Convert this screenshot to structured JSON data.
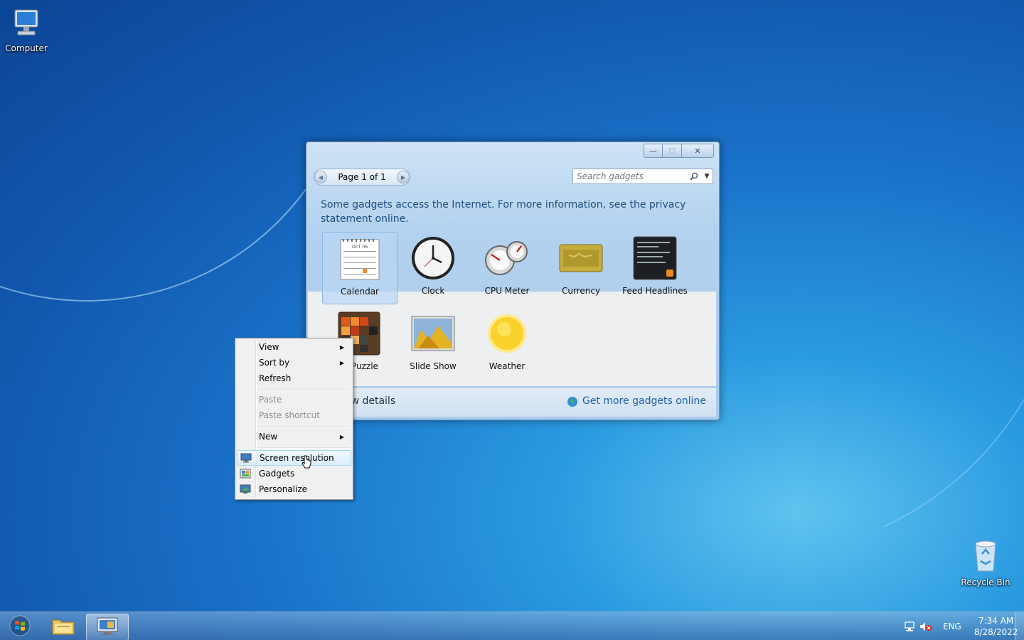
{
  "desktop": {
    "icons": [
      {
        "label": "Computer"
      },
      {
        "label": "Recycle Bin"
      }
    ]
  },
  "gadgets_window": {
    "controls": {
      "minimize": "—",
      "maximize": "☐",
      "close": "✕"
    },
    "page_nav": {
      "label": "Page 1 of 1"
    },
    "search": {
      "placeholder": "Search gadgets"
    },
    "info_text": "Some gadgets access the Internet.  For more information, see the privacy statement online.",
    "gadgets": [
      {
        "label": "Calendar",
        "selected": true
      },
      {
        "label": "Clock"
      },
      {
        "label": "CPU Meter"
      },
      {
        "label": "Currency"
      },
      {
        "label": "Feed Headlines"
      },
      {
        "label": "re Puzzle"
      },
      {
        "label": "Slide Show"
      },
      {
        "label": "Weather"
      }
    ],
    "calendar_month": "OCT 06",
    "footer": {
      "details_label": "ow details",
      "online_link": "Get more gadgets online"
    }
  },
  "context_menu": {
    "items": [
      {
        "label": "View",
        "submenu": true
      },
      {
        "label": "Sort by",
        "submenu": true
      },
      {
        "label": "Refresh"
      },
      {
        "label": "Paste",
        "disabled": true
      },
      {
        "label": "Paste shortcut",
        "disabled": true
      },
      {
        "label": "New",
        "submenu": true
      },
      {
        "label": "Screen resolution",
        "hovered": true
      },
      {
        "label": "Gadgets"
      },
      {
        "label": "Personalize"
      }
    ]
  },
  "taskbar": {
    "tray": {
      "language": "ENG",
      "time": "7:34 AM",
      "date": "8/28/2022"
    }
  },
  "colors": {
    "accent": "#1a72c9",
    "link": "#1f5fa8",
    "menu_hover": "#dcecfb"
  }
}
